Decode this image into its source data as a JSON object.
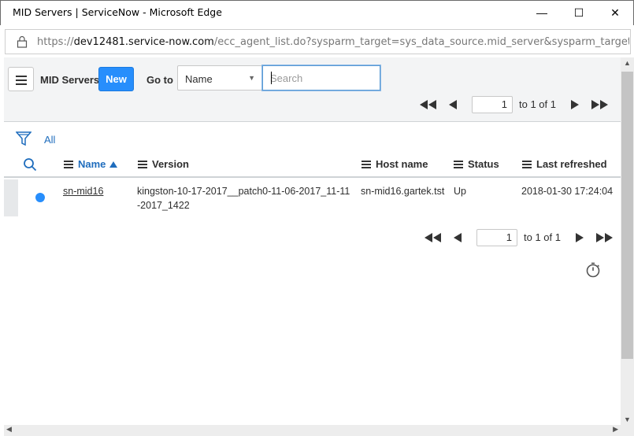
{
  "window": {
    "title": "MID Servers | ServiceNow - Microsoft Edge",
    "minimize_glyph": "—",
    "maximize_glyph": "☐",
    "close_glyph": "✕"
  },
  "address_bar": {
    "url_prefix": "https://",
    "url_host": "dev12481.service-now.com",
    "url_rest": "/ecc_agent_list.do?sysparm_target=sys_data_source.mid_server&sysparm_target_value=&sysparm"
  },
  "list_header": {
    "title": "MID Servers",
    "new_label": "New",
    "goto_label": "Go to",
    "goto_field": "Name",
    "search_placeholder": "Search",
    "search_value": ""
  },
  "pagination_top": {
    "page": "1",
    "range_text": "to 1 of 1"
  },
  "pagination_bottom": {
    "page": "1",
    "range_text": "to 1 of 1"
  },
  "filter": {
    "label": "All"
  },
  "table": {
    "columns": [
      "Name",
      "Version",
      "Host name",
      "Status",
      "Last refreshed"
    ],
    "sorted_column": "Name",
    "sort_direction": "ascending",
    "rows": [
      {
        "name": "sn-mid16",
        "version": "kingston-10-17-2017__patch0-11-06-2017_11-11-2017_1422",
        "host_name": "sn-mid16.gartek.tst",
        "status": "Up",
        "last_refreshed": "2018-01-30 17:24:04"
      }
    ]
  },
  "colors": {
    "accent": "#278efc",
    "link": "#1f6dbd",
    "header_bg": "#f3f4f5"
  },
  "icons": {
    "hamburger": "hamburger-menu-icon",
    "filter": "filter-funnel-icon",
    "search": "search-icon",
    "timer": "stopwatch-icon",
    "lock": "lock-icon"
  }
}
